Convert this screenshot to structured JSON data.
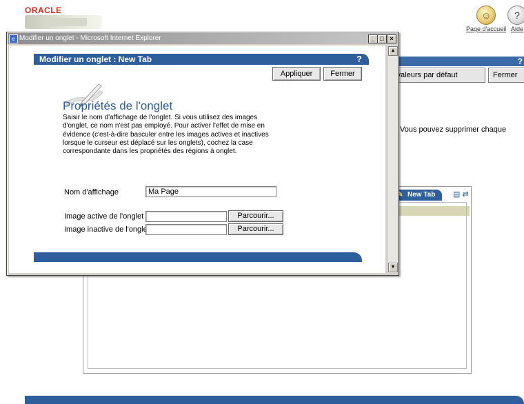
{
  "background": {
    "logo": "ORACLE",
    "home_link": "Page d'accueil",
    "help_link": "Aide",
    "titlebar_help": "?",
    "restore_defaults_btn": "s valeurs par défaut",
    "close_btn": "Fermer",
    "description": "Vous pouvez supprimer chaque",
    "tab_label": "New Tab"
  },
  "window": {
    "title": "Modifier un onglet - Microsoft Internet Explorer",
    "minimize": "_",
    "maximize": "□",
    "close": "×"
  },
  "dialog": {
    "header": "Modifier un onglet : New Tab",
    "help": "?",
    "apply_label": "Appliquer",
    "close_label": "Fermer",
    "section_title": "Propriétés de l'onglet",
    "description": "Saisir le nom d'affichage de l'onglet. Si vous utilisez des images d'onglet, ce nom n'est pas employé. Pour activer l'effet de mise en évidence (c'est-à-dire basculer entre les images actives et inactives lorsque le curseur est déplacé sur les onglets), cochez la case correspondante dans les propriétés des régions à onglet.",
    "display_name_label": "Nom d'affichage",
    "display_name_value": "Ma Page",
    "active_image_label": "Image active de l'onglet",
    "active_image_value": "",
    "inactive_image_label": "Image inactive de l'onglet",
    "inactive_image_value": "",
    "browse_label": "Parcourir..."
  },
  "colors": {
    "brand_blue": "#2e5e9c",
    "oracle_red": "#d42a1a"
  }
}
